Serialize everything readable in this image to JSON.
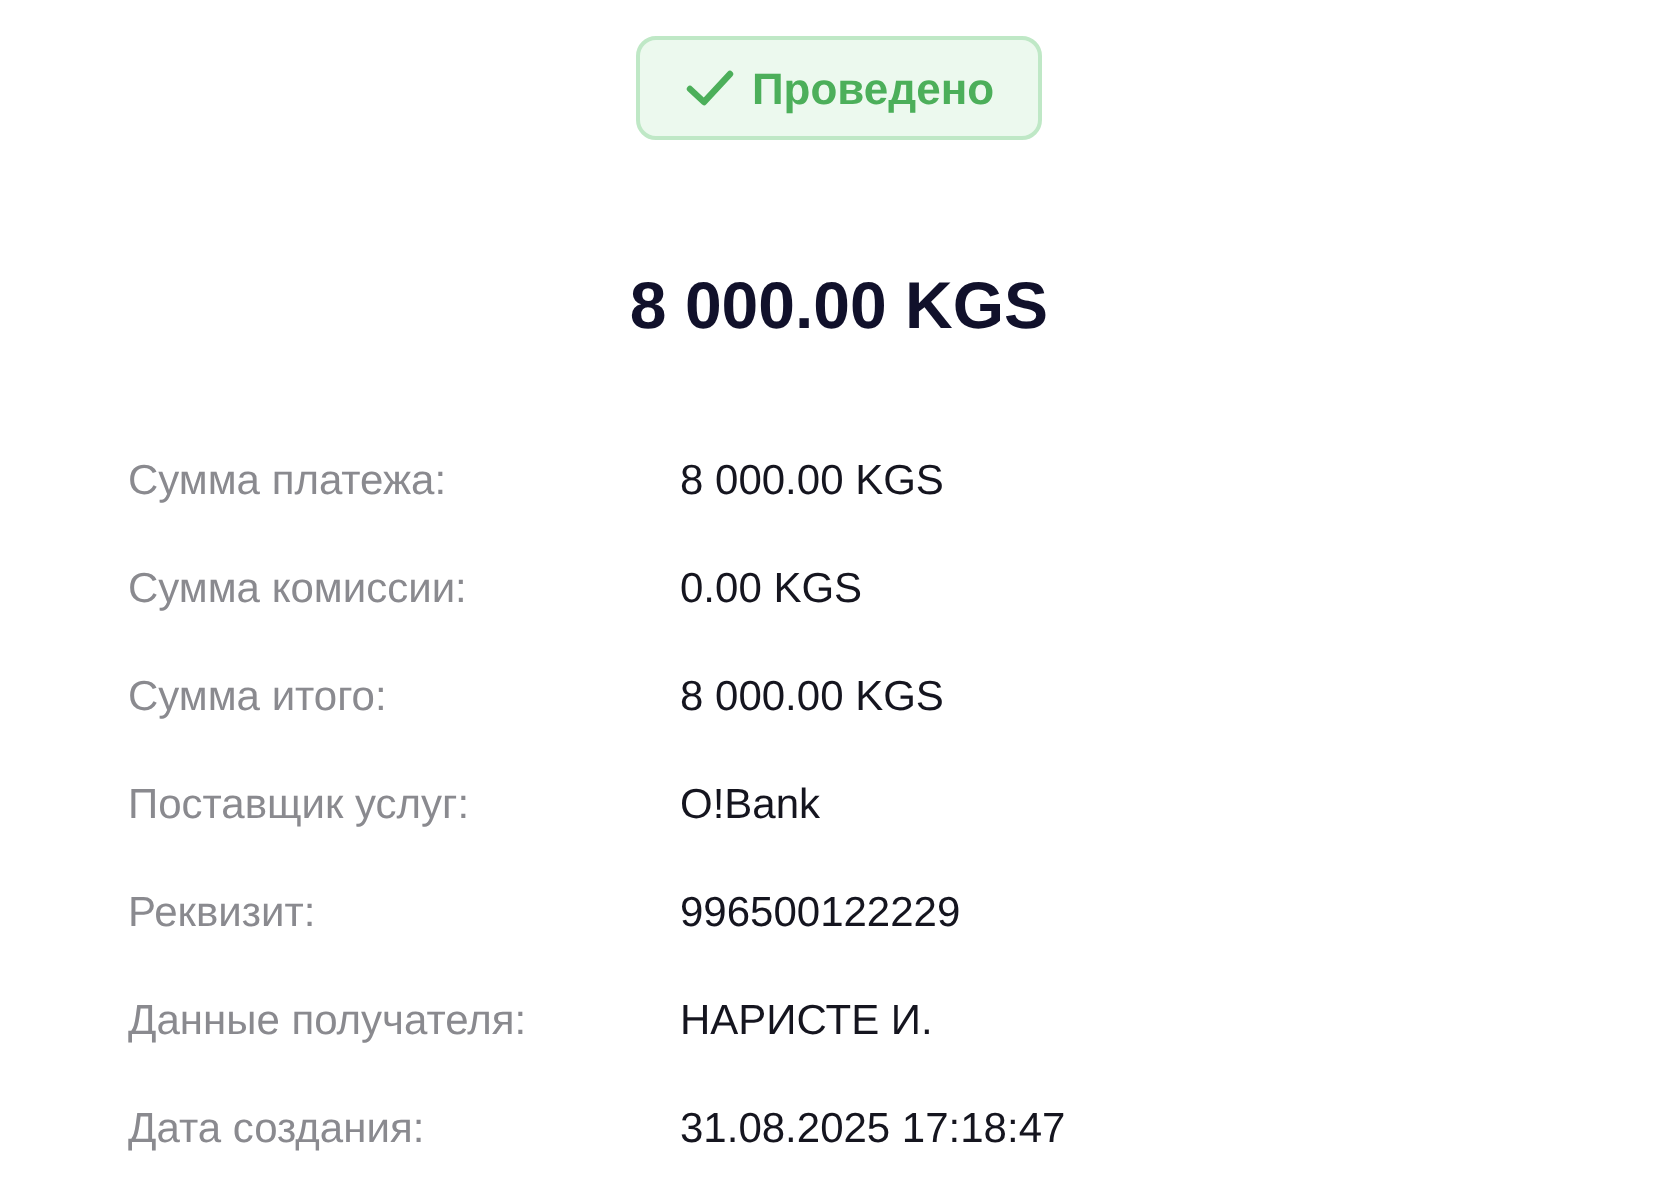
{
  "status": {
    "label": "Проведено",
    "kind": "success"
  },
  "amount": "8 000.00 KGS",
  "details": [
    {
      "label": "Сумма платежа:",
      "value": "8 000.00 KGS"
    },
    {
      "label": "Сумма комиссии:",
      "value": "0.00 KGS"
    },
    {
      "label": "Сумма итого:",
      "value": "8 000.00 KGS"
    },
    {
      "label": "Поставщик услуг:",
      "value": "O!Bank"
    },
    {
      "label": "Реквизит:",
      "value": "996500122229"
    },
    {
      "label": "Данные получателя:",
      "value": "НАРИСТЕ И."
    },
    {
      "label": "Дата создания:",
      "value": "31.08.2025 17:18:47"
    }
  ]
}
